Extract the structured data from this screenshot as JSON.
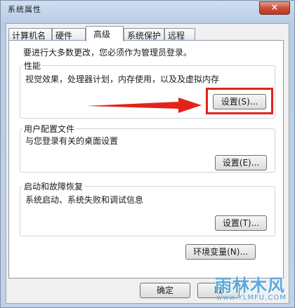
{
  "window": {
    "title": "系统属性",
    "close_glyph": "✕"
  },
  "tabs": [
    {
      "label": "计算机名"
    },
    {
      "label": "硬件"
    },
    {
      "label": "高级"
    },
    {
      "label": "系统保护"
    },
    {
      "label": "远程"
    }
  ],
  "admin_note": "要进行大多数更改，您必须作为管理员登录。",
  "performance": {
    "title": "性能",
    "description": "视觉效果，处理器计划，内存使用，以及及虚拟内存",
    "button": "设置(S)..."
  },
  "user_profiles": {
    "title": "用户配置文件",
    "description": "与您登录有关的桌面设置",
    "button": "设置(E)..."
  },
  "startup_recovery": {
    "title": "启动和故障恢复",
    "description": "系统启动、系统失败和调试信息",
    "button": "设置(T)..."
  },
  "env_button": "环境变量(N)...",
  "footer": {
    "ok": "确定",
    "cancel": "取"
  },
  "watermark": {
    "main": "雨林木风",
    "url": "www.YLMFU.COM"
  },
  "colors": {
    "highlight": "#e2231a"
  }
}
